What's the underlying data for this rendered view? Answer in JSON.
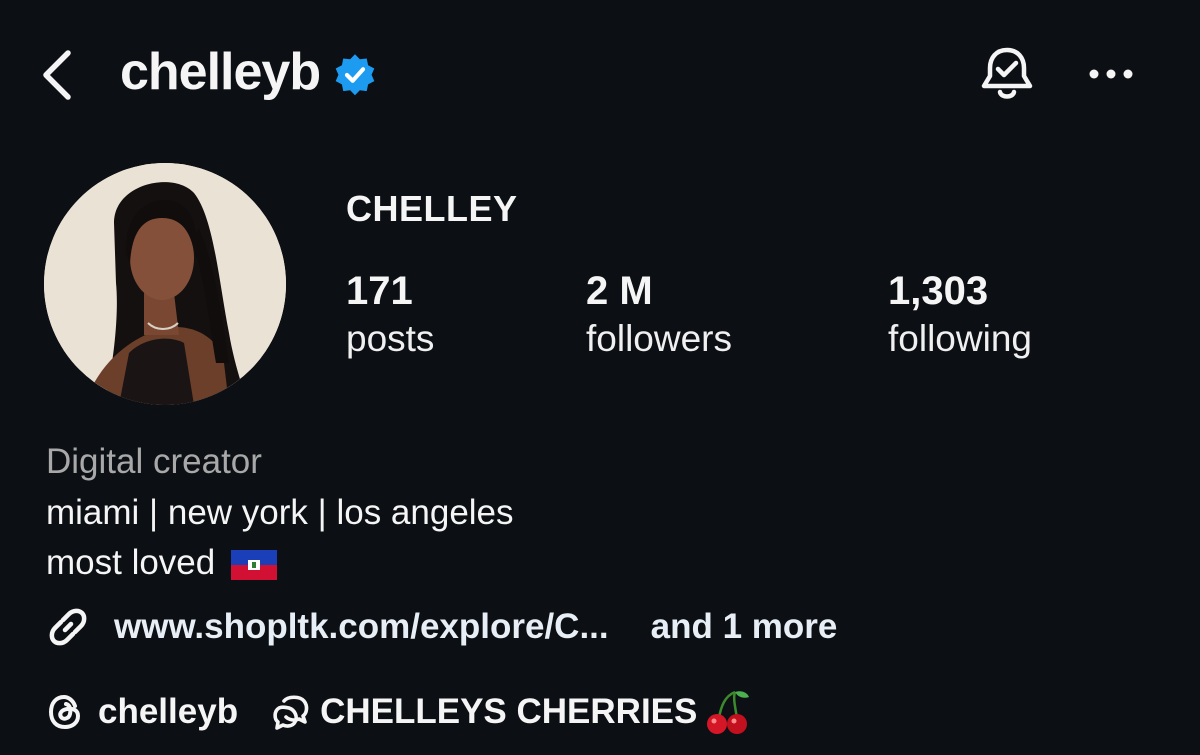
{
  "header": {
    "username": "chelleyb",
    "verified": true,
    "accent_color": "#1d9bf0"
  },
  "profile": {
    "display_name": "CHELLEY",
    "stats": [
      {
        "value": "171",
        "label": "posts"
      },
      {
        "value": "2 M",
        "label": "followers"
      },
      {
        "value": "1,303",
        "label": "following"
      }
    ],
    "category": "Digital creator",
    "bio_lines": [
      "miami | new york | los angeles",
      "most loved"
    ],
    "bio_emoji": "haiti-flag",
    "link": {
      "text": "www.shopltk.com/explore/C...",
      "more": "and 1 more"
    },
    "threads_handle": "chelleyb",
    "channel": {
      "name": "CHELLEYS CHERRIES",
      "emoji": "cherries"
    }
  },
  "icons": {
    "back": "chevron-left-icon",
    "bell": "notification-bell-check-icon",
    "more": "more-dots-icon",
    "link": "link-icon",
    "threads": "threads-icon",
    "channel": "broadcast-channel-icon"
  },
  "colors": {
    "background": "#0c1014",
    "text": "#f5f5f5",
    "secondary_text": "#a8a8a8"
  }
}
